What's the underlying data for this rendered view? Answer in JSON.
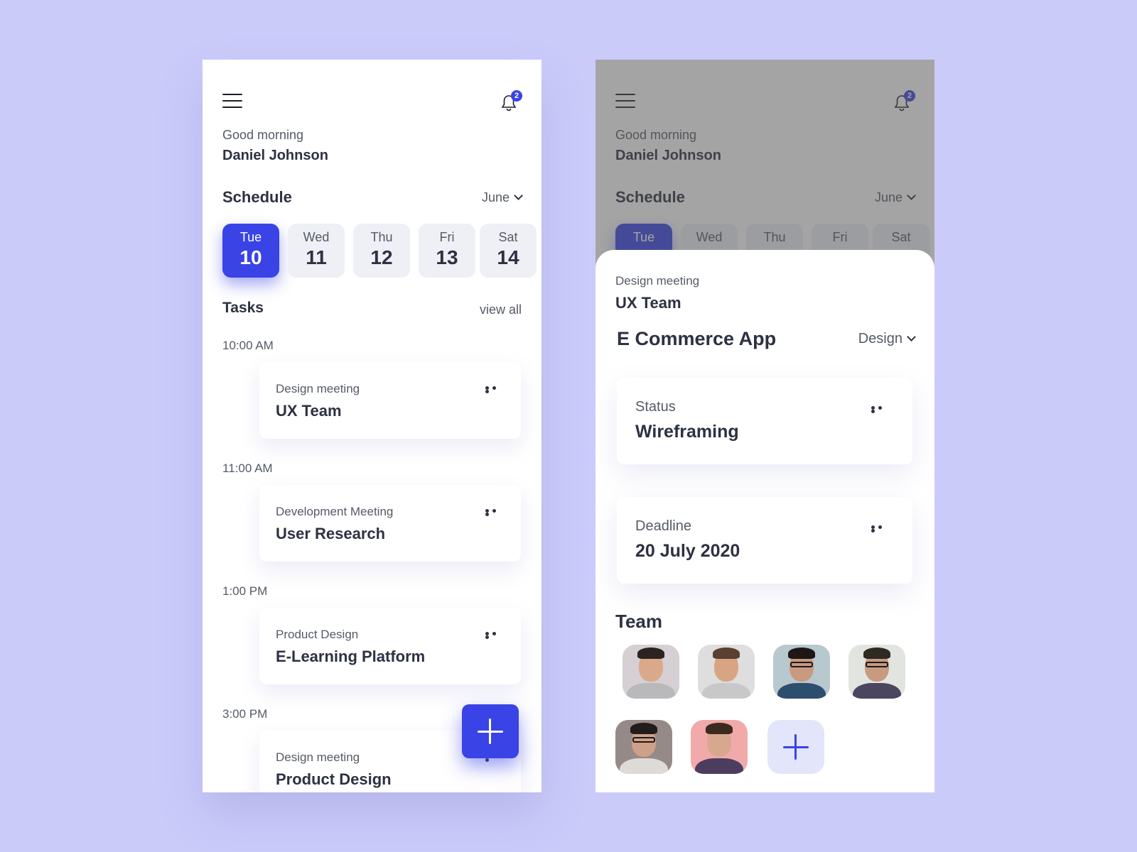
{
  "screen1": {
    "greeting": "Good morning",
    "user_name": "Daniel Johnson",
    "notifications_count": "2",
    "schedule_label": "Schedule",
    "month": "June",
    "days": [
      {
        "name": "Tue",
        "date": "10",
        "selected": true
      },
      {
        "name": "Wed",
        "date": "11",
        "selected": false
      },
      {
        "name": "Thu",
        "date": "12",
        "selected": false
      },
      {
        "name": "Fri",
        "date": "13",
        "selected": false
      },
      {
        "name": "Sat",
        "date": "14",
        "selected": false
      }
    ],
    "tasks_label": "Tasks",
    "view_all_label": "view all",
    "tasks": [
      {
        "time": "10:00 AM",
        "category": "Design meeting",
        "title": "UX Team"
      },
      {
        "time": "11:00 AM",
        "category": "Development Meeting",
        "title": "User Research"
      },
      {
        "time": "1:00 PM",
        "category": "Product Design",
        "title": "E-Learning Platform"
      },
      {
        "time": "3:00 PM",
        "category": "Design meeting",
        "title": "Product Design"
      }
    ]
  },
  "screen2": {
    "greeting": "Good morning",
    "user_name": "Daniel Johnson",
    "notifications_count": "2",
    "schedule_label": "Schedule",
    "month": "June",
    "days": [
      "Tue",
      "Wed",
      "Thu",
      "Fri",
      "Sat"
    ],
    "sheet": {
      "category": "Design meeting",
      "title": "UX Team",
      "project": "E Commerce App",
      "project_filter": "Design",
      "status_label": "Status",
      "status_value": "Wireframing",
      "deadline_label": "Deadline",
      "deadline_value": "20 July 2020",
      "team_label": "Team",
      "team_count": 6
    }
  },
  "colors": {
    "background": "#cbcbfa",
    "accent": "#3a43e6",
    "text": "#2d3142",
    "muted": "#555a66",
    "day_bg": "#eef0f6"
  }
}
